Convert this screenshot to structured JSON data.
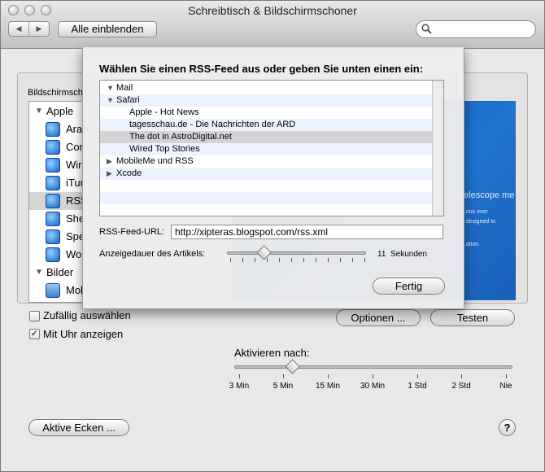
{
  "window": {
    "title": "Schreibtisch & Bildschirmschoner"
  },
  "toolbar": {
    "back_icon": "◀",
    "forward_icon": "▶",
    "show_all_label": "Alle einblenden",
    "search_placeholder": ""
  },
  "main": {
    "screensavers_label": "Bildschirmsch",
    "sources": {
      "groups": [
        {
          "label": "Apple",
          "items": [
            "Arab",
            "Com",
            "Wirb",
            "iTun",
            "RSS",
            "Shel",
            "Spec",
            "Wor"
          ]
        },
        {
          "label": "Bilder",
          "items": [
            "MobileMe und RSS"
          ]
        }
      ],
      "selected": "RSS"
    },
    "preview_texts": [
      "telescope me",
      "...nos ever",
      "...designed to",
      "...ation."
    ],
    "random_label": "Zufällig auswählen",
    "random_checked": false,
    "clock_label": "Mit Uhr anzeigen",
    "clock_checked": true,
    "options_label": "Optionen ...",
    "test_label": "Testen",
    "activate_label": "Aktivieren nach:",
    "activate_ticks": [
      "3 Min",
      "5 Min",
      "15 Min",
      "30 Min",
      "1 Std",
      "2 Std",
      "Nie"
    ],
    "activate_value": "5 Min",
    "hot_corners_label": "Aktive Ecken ...",
    "help_label": "?"
  },
  "sheet": {
    "title": "Wählen Sie einen RSS-Feed aus oder geben Sie unten einen ein:",
    "feeds": [
      {
        "label": "Mail",
        "level": 0,
        "expanded": true
      },
      {
        "label": "Safari",
        "level": 0,
        "expanded": true
      },
      {
        "label": "Apple - Hot News",
        "level": 1
      },
      {
        "label": "tagesschau.de - Die Nachrichten der ARD",
        "level": 1
      },
      {
        "label": "The dot in AstroDigital.net",
        "level": 1,
        "selected": true
      },
      {
        "label": "Wired Top Stories",
        "level": 1
      },
      {
        "label": "MobileMe und RSS",
        "level": 0,
        "expanded": false
      },
      {
        "label": "Xcode",
        "level": 0,
        "expanded": false
      }
    ],
    "url_label": "RSS-Feed-URL:",
    "url_value": "http://xipteras.blogspot.com/rss.xml",
    "duration_label": "Anzeigedauer des Artikels:",
    "duration_value": "11",
    "duration_unit": "Sekunden",
    "done_label": "Fertig"
  },
  "colors": {
    "accent": "#1f74d0",
    "selection": "#d4d4d4",
    "alt_row": "#edf3fe"
  }
}
